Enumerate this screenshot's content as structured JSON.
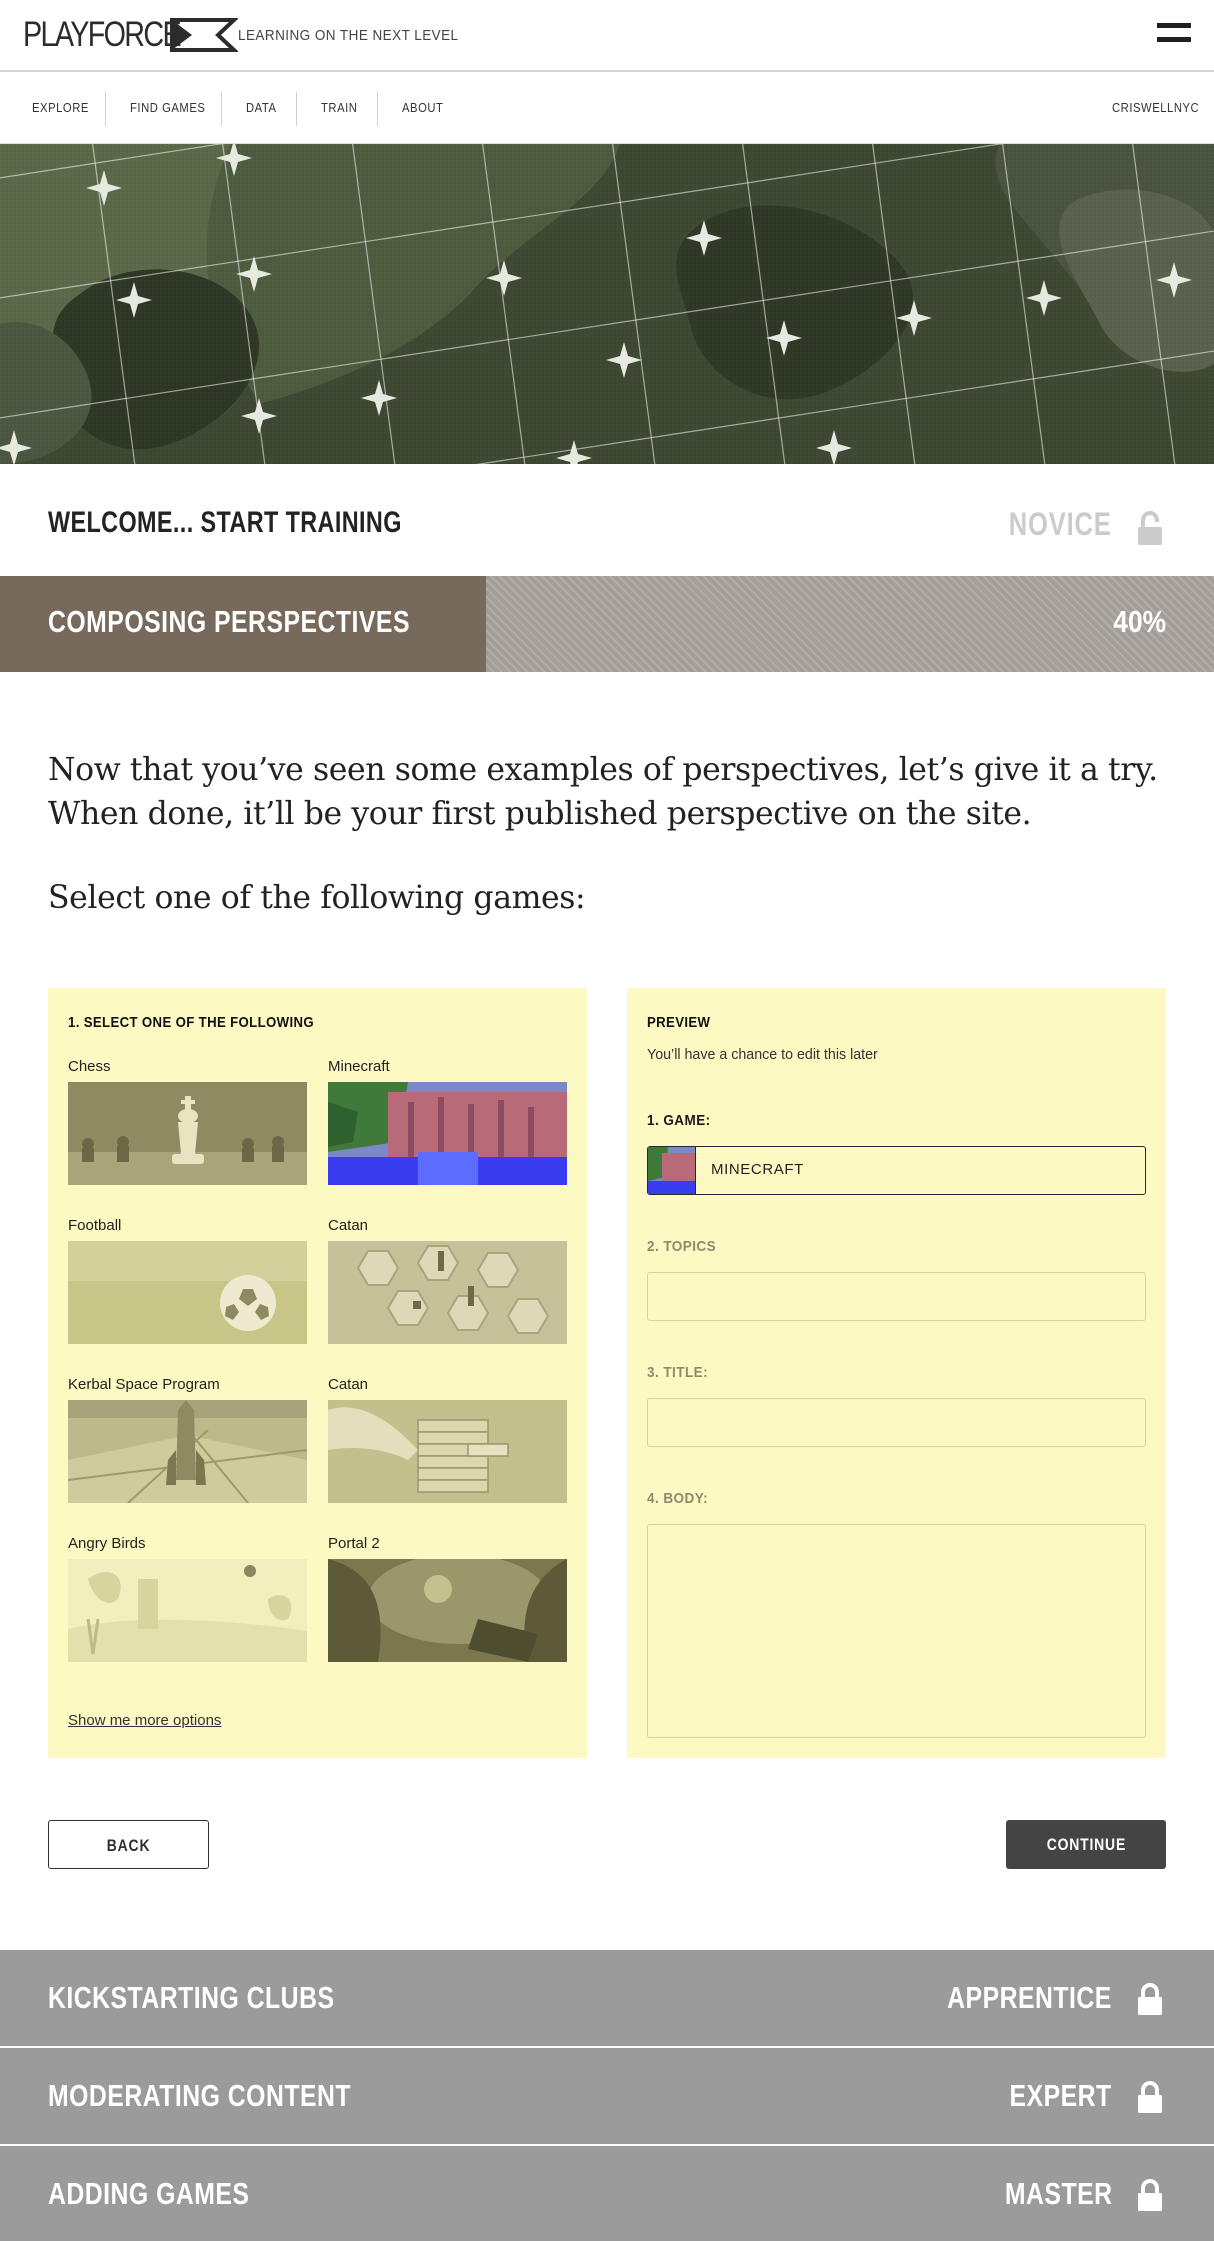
{
  "header": {
    "logo_text": "PLAYFORCE",
    "tagline": "LEARNING ON THE NEXT LEVEL",
    "menu_icon": "hamburger-menu-icon"
  },
  "nav": {
    "items": [
      {
        "label": "EXPLORE"
      },
      {
        "label": "FIND GAMES"
      },
      {
        "label": "DATA"
      },
      {
        "label": "TRAIN"
      },
      {
        "label": "ABOUT"
      }
    ],
    "user": "CRISWELLNYC"
  },
  "welcome": {
    "title": "WELCOME... START TRAINING",
    "rank": "NOVICE",
    "rank_icon": "unlocked-padlock-icon"
  },
  "progress": {
    "title": "COMPOSING PERSPECTIVES",
    "percent_label": "40%",
    "value": 0.4
  },
  "intro": {
    "text": "Now that you’ve seen some examples of perspectives, let’s give it a try. When done, it’ll be your first published perspective on the site.",
    "prompt": "Select one of the following games:"
  },
  "select_panel": {
    "heading": "1. SELECT ONE OF THE FOLLOWING",
    "games": [
      {
        "label": "Chess"
      },
      {
        "label": "Minecraft"
      },
      {
        "label": "Football"
      },
      {
        "label": "Catan"
      },
      {
        "label": "Kerbal Space Program"
      },
      {
        "label": "Catan"
      },
      {
        "label": "Angry Birds"
      },
      {
        "label": "Portal 2"
      }
    ],
    "more_link": "Show me more options"
  },
  "preview_panel": {
    "heading": "PREVIEW",
    "subtitle": "You’ll have a chance to edit this later",
    "game_label": "1. GAME:",
    "game_value": "MINECRAFT",
    "topics_label": "2. TOPICS",
    "title_label": "3. TITLE:",
    "body_label": "4. BODY:",
    "active_label_color": "#1a1a1a",
    "inactive_label_color": "#8f8a6b"
  },
  "actions": {
    "back": "BACK",
    "continue": "CONTINUE"
  },
  "locked_levels": [
    {
      "title": "KICKSTARTING CLUBS",
      "rank": "APPRENTICE",
      "icon": "locked-padlock-icon"
    },
    {
      "title": "MODERATING CONTENT",
      "rank": "EXPERT",
      "icon": "locked-padlock-icon"
    },
    {
      "title": "ADDING GAMES",
      "rank": "MASTER",
      "icon": "locked-padlock-icon"
    }
  ],
  "colors": {
    "panel_bg": "#fdf9c3",
    "progress_fill": "#77695b",
    "progress_track": "#a39d98",
    "locked_level_bg": "#9b9b9b",
    "continue_bg": "#444444"
  }
}
